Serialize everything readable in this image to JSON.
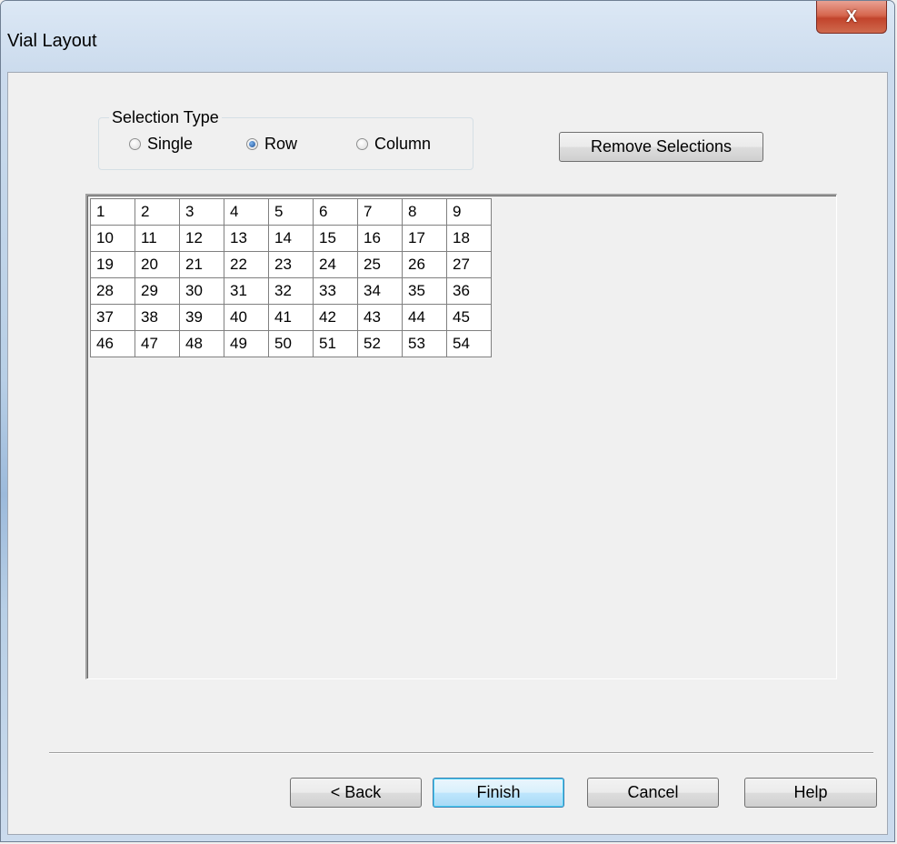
{
  "window": {
    "title": "Vial Layout",
    "close_label": "X"
  },
  "selection_type": {
    "label": "Selection Type",
    "options": [
      {
        "label": "Single",
        "checked": false
      },
      {
        "label": "Row",
        "checked": true
      },
      {
        "label": "Column",
        "checked": false
      }
    ]
  },
  "remove_selections_label": "Remove Selections",
  "vial_grid": {
    "rows": [
      [
        "1",
        "2",
        "3",
        "4",
        "5",
        "6",
        "7",
        "8",
        "9"
      ],
      [
        "10",
        "11",
        "12",
        "13",
        "14",
        "15",
        "16",
        "17",
        "18"
      ],
      [
        "19",
        "20",
        "21",
        "22",
        "23",
        "24",
        "25",
        "26",
        "27"
      ],
      [
        "28",
        "29",
        "30",
        "31",
        "32",
        "33",
        "34",
        "35",
        "36"
      ],
      [
        "37",
        "38",
        "39",
        "40",
        "41",
        "42",
        "43",
        "44",
        "45"
      ],
      [
        "46",
        "47",
        "48",
        "49",
        "50",
        "51",
        "52",
        "53",
        "54"
      ]
    ]
  },
  "footer": {
    "back_label": "< Back",
    "finish_label": "Finish",
    "cancel_label": "Cancel",
    "help_label": "Help"
  }
}
